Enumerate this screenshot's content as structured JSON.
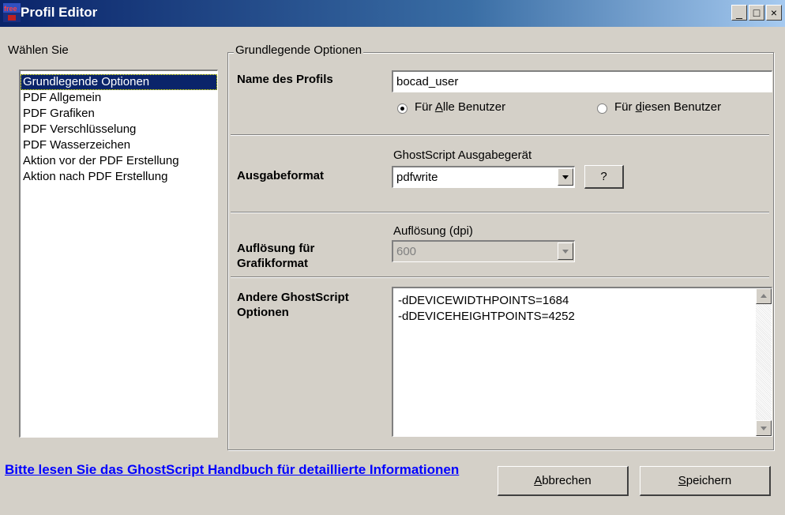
{
  "window": {
    "title": "Profil Editor",
    "icon_text": "free",
    "controls": {
      "minimize": "_",
      "maximize": "□",
      "close": "×"
    }
  },
  "sidebar": {
    "label": "Wählen Sie",
    "items": [
      {
        "label": "Grundlegende Optionen",
        "selected": true
      },
      {
        "label": "PDF Allgemein"
      },
      {
        "label": "PDF Grafiken"
      },
      {
        "label": "PDF Verschlüsselung"
      },
      {
        "label": "PDF Wasserzeichen"
      },
      {
        "label": "Aktion vor der PDF Erstellung"
      },
      {
        "label": "Aktion nach PDF Erstellung"
      }
    ]
  },
  "group": {
    "title": "Grundlegende Optionen",
    "profile": {
      "label": "Name des Profils",
      "value": "bocad_user",
      "radio_all": {
        "pre": "Für ",
        "key": "A",
        "post": "lle Benutzer",
        "checked": true
      },
      "radio_this": {
        "pre": "Für ",
        "key": "d",
        "post": "iesen Benutzer",
        "checked": false
      }
    },
    "output": {
      "label": "Ausgabeformat",
      "caption": "GhostScript Ausgabegerät",
      "selected": "pdfwrite",
      "help_button": "?"
    },
    "resolution": {
      "label": "Auflösung für Grafikformat",
      "caption": "Auflösung (dpi)",
      "selected": "600"
    },
    "options": {
      "label": "Andere GhostScript Optionen",
      "lines": [
        "-dDEVICEWIDTHPOINTS=1684",
        "-dDEVICEHEIGHTPOINTS=4252"
      ]
    }
  },
  "footer": {
    "link": "Bitte lesen Sie das GhostScript Handbuch für detaillierte Informationen",
    "cancel": {
      "key": "A",
      "rest": "bbrechen"
    },
    "save": {
      "key": "S",
      "rest": "peichern"
    }
  }
}
